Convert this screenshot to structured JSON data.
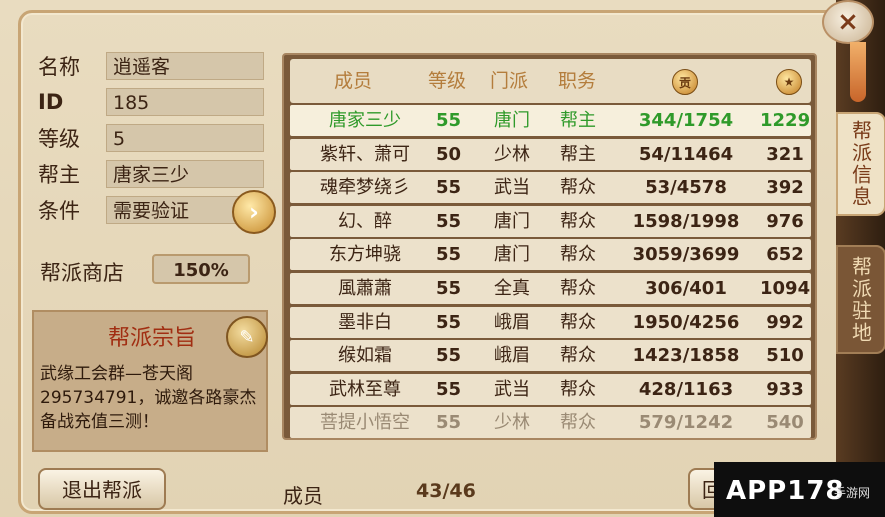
{
  "close_icon": "×",
  "tabs": [
    {
      "label": "帮派信息",
      "active": true
    },
    {
      "label": "帮派驻地",
      "active": false
    }
  ],
  "info": {
    "name_label": "名称",
    "name_value": "逍遥客",
    "id_label": "ID",
    "id_value": "185",
    "level_label": "等级",
    "level_value": "5",
    "leader_label": "帮主",
    "leader_value": "唐家三少",
    "condition_label": "条件",
    "condition_value": "需要验证",
    "arrow_icon": "›"
  },
  "shop": {
    "label": "帮派商店",
    "value": "150%"
  },
  "motto": {
    "title": "帮派宗旨",
    "text": "武缘工会群—苍天阁 295734791，诚邀各路豪杰备战充值三测！",
    "icon": "✎"
  },
  "table": {
    "headers": [
      "成员",
      "等级",
      "门派",
      "职务"
    ],
    "contrib_icon": "贡",
    "rank_icon": "★",
    "rows": [
      {
        "name": "唐家三少",
        "level": "55",
        "sect": "唐门",
        "role": "帮主",
        "contrib": "344/1754",
        "score": "1229"
      },
      {
        "name": "紫轩、萧可",
        "level": "50",
        "sect": "少林",
        "role": "帮主",
        "contrib": "54/11464",
        "score": "321"
      },
      {
        "name": "魂牵梦绕彡",
        "level": "55",
        "sect": "武当",
        "role": "帮众",
        "contrib": "53/4578",
        "score": "392"
      },
      {
        "name": "幻、醉",
        "level": "55",
        "sect": "唐门",
        "role": "帮众",
        "contrib": "1598/1998",
        "score": "976"
      },
      {
        "name": "东方坤骁",
        "level": "55",
        "sect": "唐门",
        "role": "帮众",
        "contrib": "3059/3699",
        "score": "652"
      },
      {
        "name": "風蕭蕭",
        "level": "55",
        "sect": "全真",
        "role": "帮众",
        "contrib": "306/401",
        "score": "1094"
      },
      {
        "name": "墨非白",
        "level": "55",
        "sect": "峨眉",
        "role": "帮众",
        "contrib": "1950/4256",
        "score": "992"
      },
      {
        "name": "缑如霜",
        "level": "55",
        "sect": "峨眉",
        "role": "帮众",
        "contrib": "1423/1858",
        "score": "510"
      },
      {
        "name": "武林至尊",
        "level": "55",
        "sect": "武当",
        "role": "帮众",
        "contrib": "428/1163",
        "score": "933"
      },
      {
        "name": "菩提小悟空",
        "level": "55",
        "sect": "少林",
        "role": "帮众",
        "contrib": "579/1242",
        "score": "540"
      }
    ]
  },
  "footer": {
    "leave_label": "退出帮派",
    "member_label": "成员",
    "member_count": "43/46",
    "back_label": "回"
  },
  "watermark": {
    "main": "APP178",
    "sub": "手游网"
  }
}
